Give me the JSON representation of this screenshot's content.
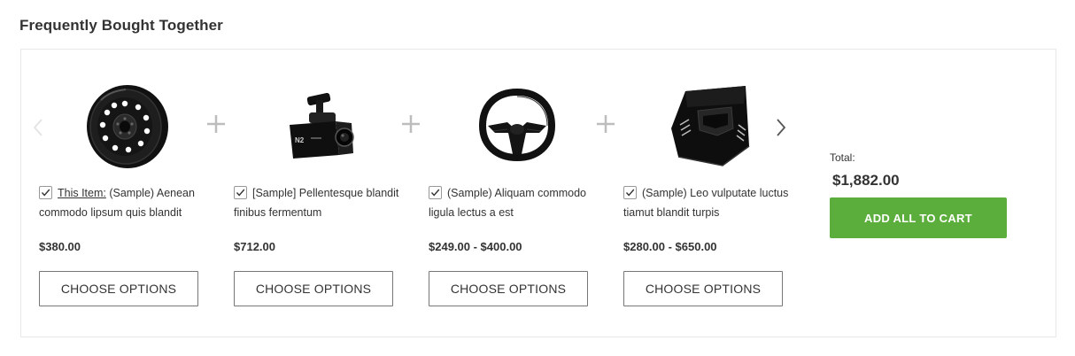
{
  "section": {
    "title": "Frequently Bought Together"
  },
  "carousel": {
    "prev_icon": "chevron-left-icon",
    "next_icon": "chevron-right-icon",
    "separator_icon": "plus-icon"
  },
  "items": [
    {
      "checked": true,
      "this_item_label": "This Item:",
      "name": "(Sample) Aenean commodo lipsum quis blandit",
      "price": "$380.00",
      "button_label": "CHOOSE OPTIONS",
      "image": "steel-wheel"
    },
    {
      "checked": true,
      "this_item_label": "",
      "name": "[Sample] Pellentesque blandit finibus fermentum",
      "price": "$712.00",
      "button_label": "CHOOSE OPTIONS",
      "image": "dash-camera"
    },
    {
      "checked": true,
      "this_item_label": "",
      "name": "(Sample) Aliquam commodo ligula lectus a est",
      "price": "$249.00 - $400.00",
      "button_label": "CHOOSE OPTIONS",
      "image": "steering-wheel"
    },
    {
      "checked": true,
      "this_item_label": "",
      "name": "(Sample) Leo vulputate luctus tiamut blandit turpis",
      "price": "$280.00 - $650.00",
      "button_label": "CHOOSE OPTIONS",
      "image": "carbon-hood"
    }
  ],
  "summary": {
    "total_label": "Total:",
    "total_value": "$1,882.00",
    "add_all_label": "ADD ALL TO CART"
  },
  "colors": {
    "accent": "#5cae3c",
    "text": "#333333",
    "border": "#e8e8e8",
    "icon_gray": "#bdbdbd"
  }
}
